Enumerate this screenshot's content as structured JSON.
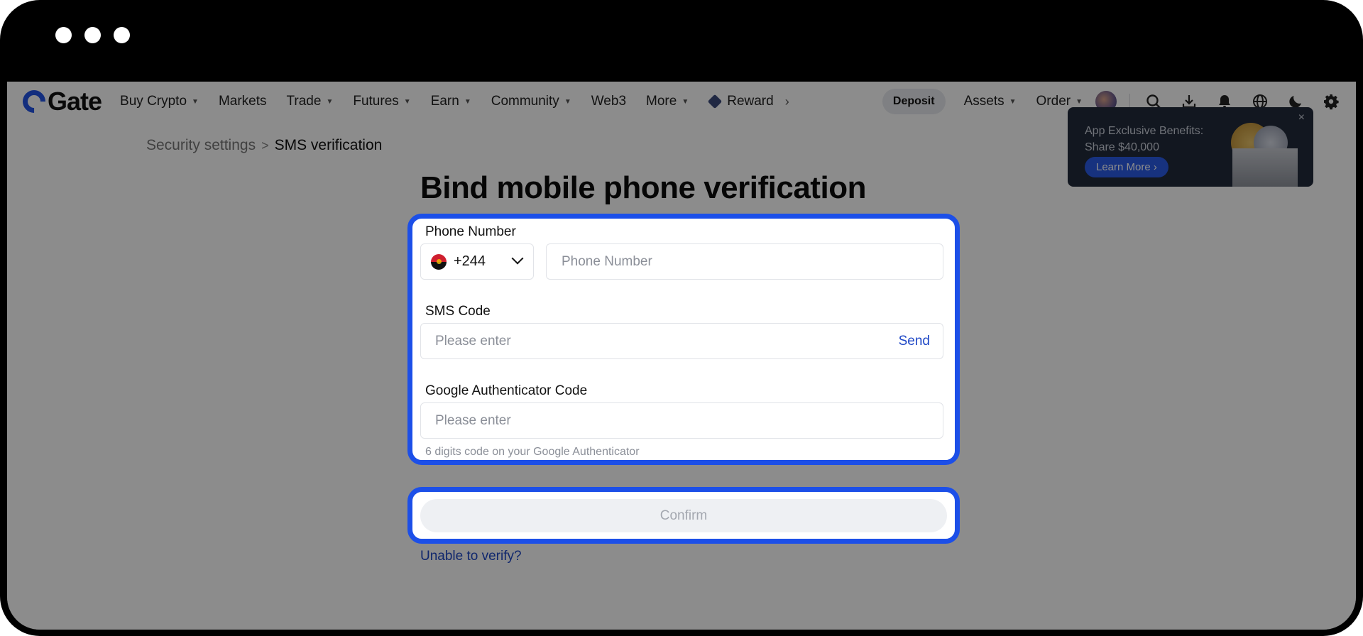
{
  "window": {
    "controls": [
      "close",
      "minimize",
      "maximize"
    ]
  },
  "nav": {
    "logo": "Gate",
    "items": [
      {
        "label": "Buy Crypto",
        "dropdown": true
      },
      {
        "label": "Markets",
        "dropdown": false
      },
      {
        "label": "Trade",
        "dropdown": true
      },
      {
        "label": "Futures",
        "dropdown": true
      },
      {
        "label": "Earn",
        "dropdown": true
      },
      {
        "label": "Community",
        "dropdown": true
      },
      {
        "label": "Web3",
        "dropdown": false
      },
      {
        "label": "More",
        "dropdown": true
      },
      {
        "label": "Reward",
        "dropdown": false
      }
    ],
    "deposit_label": "Deposit",
    "assets_label": "Assets",
    "order_label": "Order",
    "icons": [
      "search-icon",
      "download-icon",
      "bell-icon",
      "globe-icon",
      "moon-icon",
      "gear-icon"
    ]
  },
  "breadcrumb": {
    "parent": "Security settings",
    "separator": ">",
    "current": "SMS verification"
  },
  "page": {
    "title": "Bind mobile phone verification"
  },
  "form": {
    "phone_label": "Phone Number",
    "country_code": "+244",
    "phone_placeholder": "Phone Number",
    "sms_label": "SMS Code",
    "sms_placeholder": "Please enter",
    "send_label": "Send",
    "ga_label": "Google Authenticator Code",
    "ga_placeholder": "Please enter",
    "ga_hint": "6 digits code on your Google Authenticator",
    "confirm_label": "Confirm",
    "unable_label": "Unable to verify?"
  },
  "promo": {
    "line1": "App Exclusive Benefits:",
    "line2": "Share $40,000",
    "button": "Learn More",
    "close": "×"
  },
  "colors": {
    "accent": "#1c4fe8",
    "link": "#1e47c6",
    "overlay": "rgba(0,0,0,0.45)"
  }
}
